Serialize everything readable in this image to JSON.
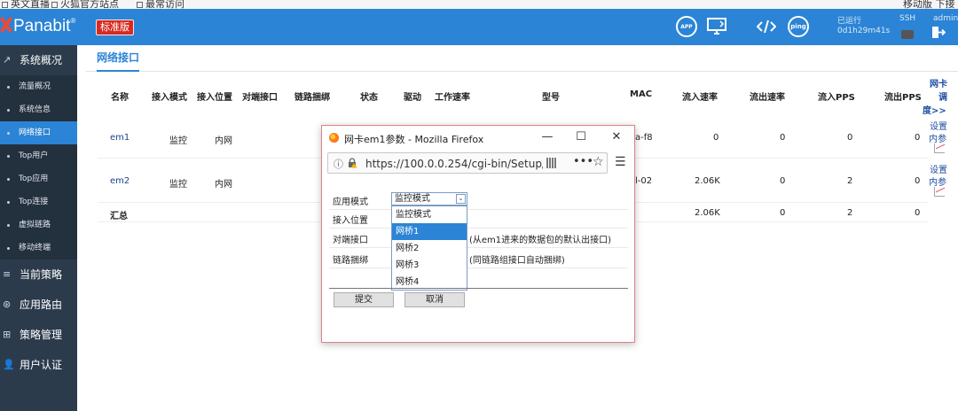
{
  "bookmarks": [
    "英文直播",
    "火狐官方站点",
    "最常访问"
  ],
  "header": {
    "brand": "Panabit",
    "edition": "标准版",
    "icons": [
      "app-icon",
      "monitor-upload-icon",
      "code-icon",
      "ping-icon"
    ],
    "ping_text": "ping",
    "runtime_label": "已运行",
    "runtime_value": "0d1h29m41s",
    "ssh_label": "SSH",
    "admin_label": "admin",
    "top_right_cut": "移动版 下接"
  },
  "sidebar": {
    "main_items": [
      {
        "label": "系统概况",
        "icon": "chart-icon"
      },
      {
        "label": "当前策略",
        "icon": "list-icon"
      },
      {
        "label": "应用路由",
        "icon": "route-icon"
      },
      {
        "label": "策略管理",
        "icon": "policy-icon"
      },
      {
        "label": "用户认证",
        "icon": "user-icon"
      }
    ],
    "sub_items": [
      "流量概况",
      "系统信息",
      "网络接口",
      "Top用户",
      "Top应用",
      "Top连接",
      "虚拟链路",
      "移动终端"
    ],
    "active_sub": "网络接口"
  },
  "tab": "网络接口",
  "table": {
    "headers": [
      "名称",
      "接入模式",
      "接入位置",
      "对端接口",
      "链路捆绑",
      "状态",
      "驱动",
      "工作速率",
      "型号",
      "MAC",
      "流入速率",
      "流出速率",
      "流入PPS",
      "流出PPS"
    ],
    "right_header": [
      "网卡",
      "调",
      "度>>"
    ],
    "rows": [
      {
        "name": "em1",
        "mode": "监控",
        "position": "内网",
        "mac_tail": "a-f8",
        "in_rate": "0",
        "out_rate": "0",
        "in_pps": "0",
        "out_pps": "0",
        "actions": [
          "设置",
          "内参"
        ]
      },
      {
        "name": "em2",
        "mode": "监控",
        "position": "内网",
        "mac_tail": "l-02",
        "in_rate": "2.06K",
        "out_rate": "0",
        "in_pps": "2",
        "out_pps": "0",
        "actions": [
          "设置",
          "内参"
        ]
      }
    ],
    "total": {
      "label": "汇总",
      "in_rate": "2.06K",
      "out_rate": "0",
      "in_pps": "2",
      "out_pps": "0"
    }
  },
  "popup": {
    "title": "网卡em1参数 - Mozilla Firefox",
    "url": "https://100.0.0.254/cgi-bin/Setup/",
    "window_buttons": [
      "—",
      "☐",
      "✕"
    ],
    "fields": [
      "应用模式",
      "接入位置",
      "对端接口",
      "链路捆绑"
    ],
    "select_value": "监控模式",
    "options": [
      "监控模式",
      "网桥1",
      "网桥2",
      "网桥3",
      "网桥4"
    ],
    "highlighted_option": "网桥1",
    "hint_peer": "(从em1进来的数据包的默认出接口)",
    "hint_bundle": "(同链路组接口自动捆绑)",
    "submit": "提交",
    "cancel": "取消"
  }
}
